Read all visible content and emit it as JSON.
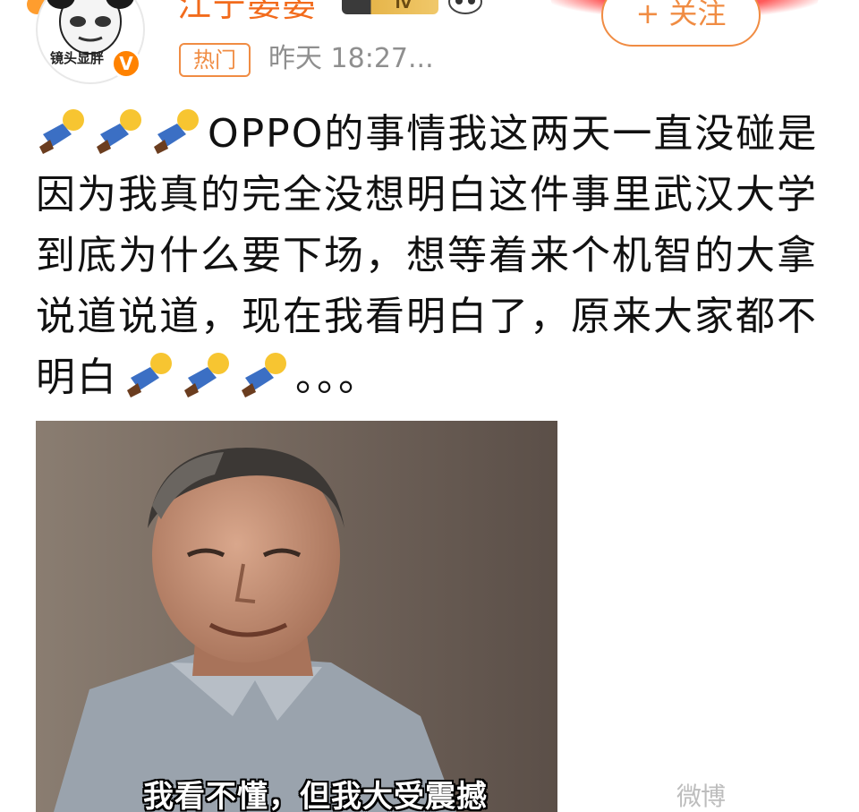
{
  "header": {
    "avatar_caption": "镜头显胖",
    "verified_mark": "V",
    "username": "江宁晏晏",
    "level_label": "IV",
    "hot_tag": "热门",
    "post_time": "昨天 18:27...",
    "follow_label": "+ 关注"
  },
  "post": {
    "text_main": "OPPO的事情我这两天一直没碰是因为我真的完全没想明白这件事里武汉大学到底为什么要下场，想等着来个机智的大拿说道说道，现在我看明白了，原来大家都不明白",
    "ellipsis": "。。。",
    "emoji_icon": "kneel-emoji-icon"
  },
  "image": {
    "caption": "我看不懂，但我大受震撼"
  },
  "watermark": "微博",
  "colors": {
    "accent": "#f08c43",
    "username": "#f26b1c",
    "time": "#8f8f8f",
    "verified": "#ff8200"
  }
}
